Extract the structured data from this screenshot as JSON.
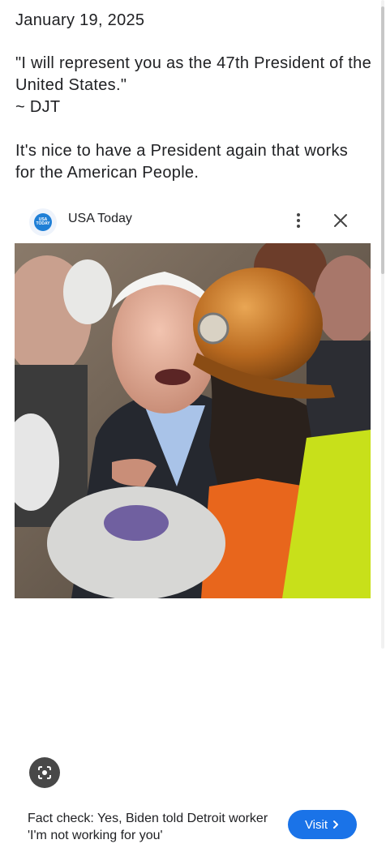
{
  "post": {
    "date": "January 19, 2025",
    "quote_line1": "\"I will represent you as the 47th President of the United States.\"",
    "attribution": "~ DJT",
    "comment": "It's nice to have a President again that works for the American People."
  },
  "card": {
    "source_name": "USA Today",
    "source_logo_text": "USA TODAY",
    "headline": "Fact check: Yes, Biden told Detroit worker 'I'm not working for you'",
    "visit_label": "Visit",
    "icons": {
      "more": "more-vert-icon",
      "close": "close-icon",
      "lens": "google-lens-icon",
      "visit_arrow": "chevron-right-icon"
    }
  },
  "colors": {
    "accent": "#1a73e8",
    "text": "#202124",
    "logo_blue": "#1f7fd6"
  }
}
